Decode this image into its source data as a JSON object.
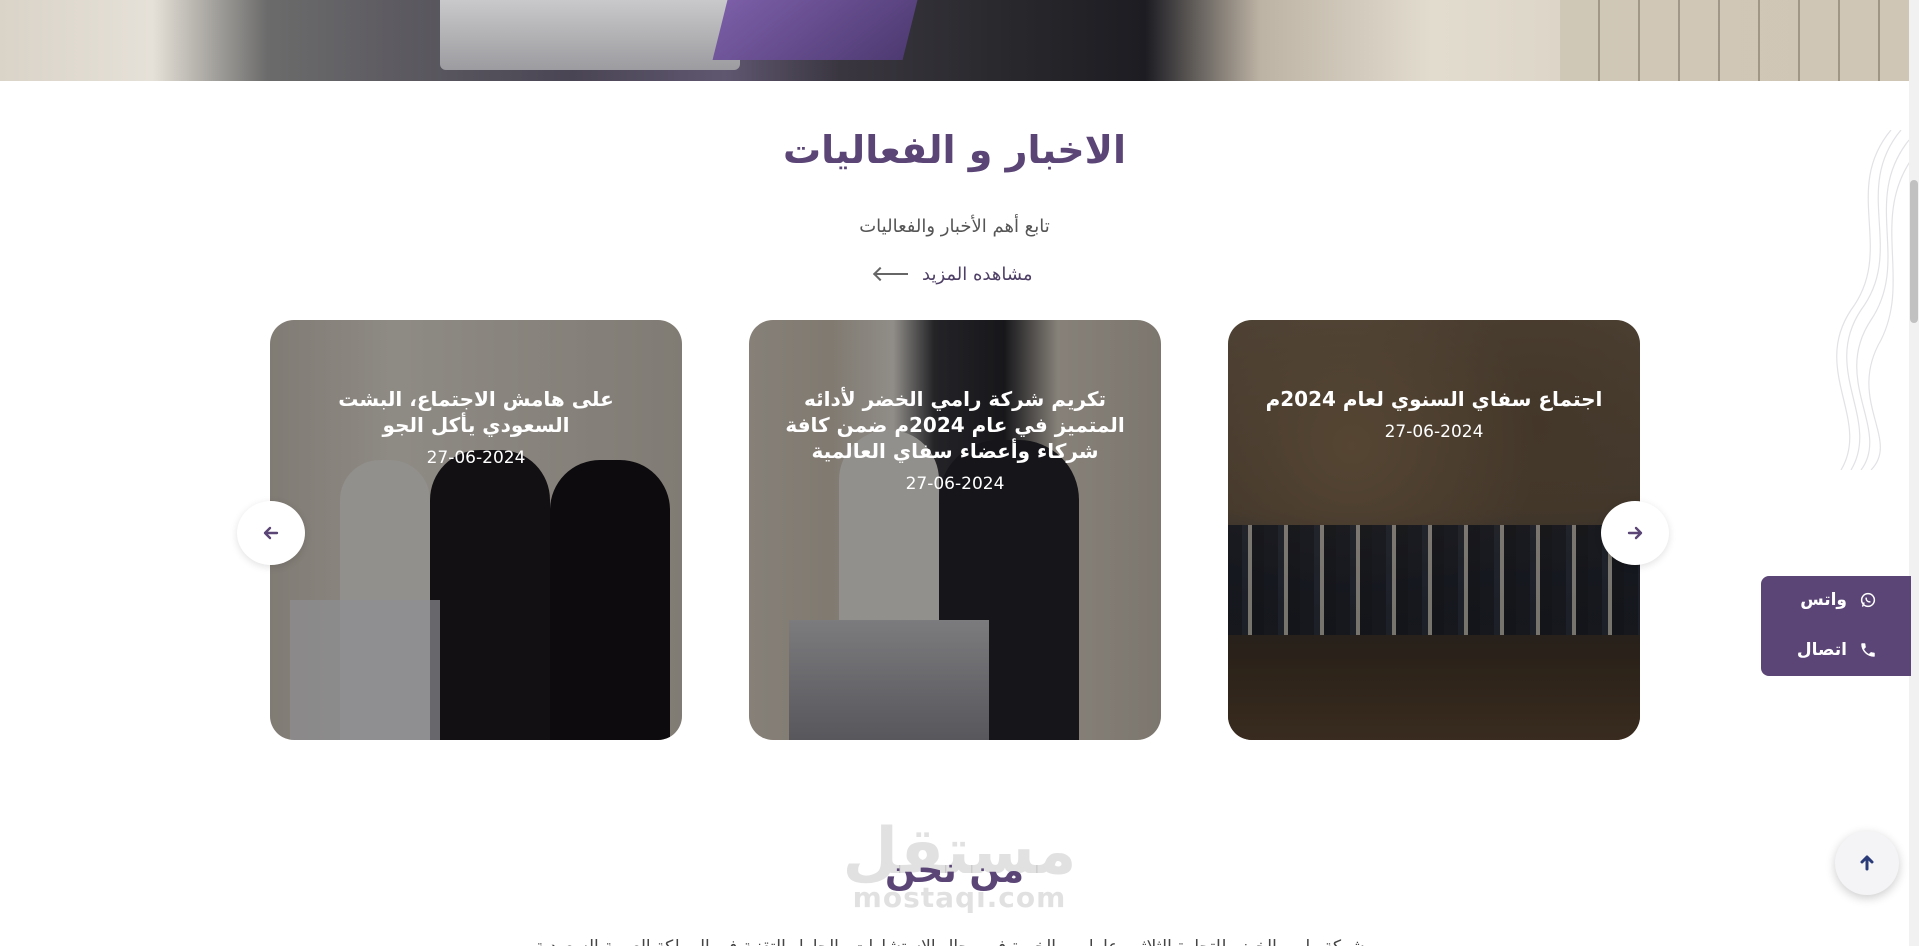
{
  "colors": {
    "brand": "#5a4576",
    "text": "#555555",
    "white": "#ffffff"
  },
  "news_section": {
    "title": "الاخبار و الفعاليات",
    "subtitle": "تابع أهم الأخبار والفعاليات",
    "see_more": "مشاهده المزيد",
    "cards": [
      {
        "title": "اجتماع سفاي السنوي لعام 2024م",
        "date": "27-06-2024"
      },
      {
        "title": "تكريم شركة رامي الخضر لأدائه المتميز في عام 2024م ضمن كافة شركاء وأعضاء سفاي العالمية",
        "date": "27-06-2024"
      },
      {
        "title": "على هامش الاجتماع، البشت السعودي يأكل الجو",
        "date": "27-06-2024"
      }
    ],
    "prev_icon": "arrow-left-icon",
    "next_icon": "arrow-right-icon"
  },
  "contact_widget": {
    "whatsapp_label": "واتس",
    "call_label": "اتصال",
    "whatsapp_icon": "whatsapp-icon",
    "call_icon": "phone-icon"
  },
  "scroll_top": {
    "icon": "arrow-up-icon"
  },
  "about_section": {
    "title": "من نحن",
    "text": "شركة رامي الخضر للتجارة الثلاثين عاما من الخبرة في مجال الاستشارات والحلول التقنية في المملكة العربية السعودية"
  },
  "watermark": {
    "arabic": "مستقل",
    "latin": "mostaqi.com"
  }
}
